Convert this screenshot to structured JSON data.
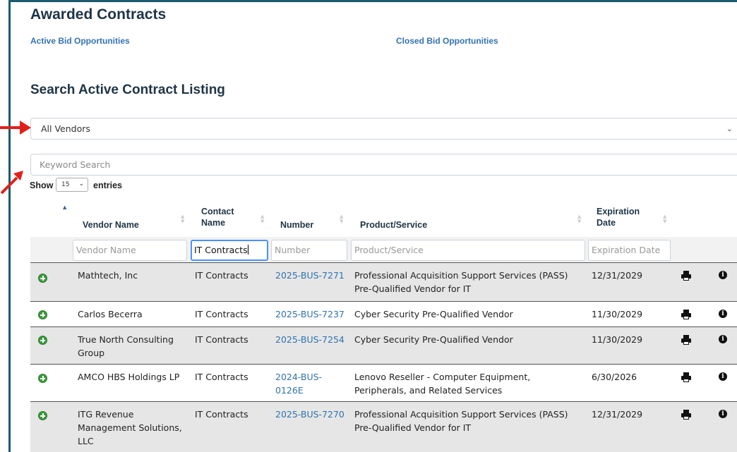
{
  "page": {
    "title": "Awarded Contracts",
    "links": {
      "active": "Active Bid Opportunities",
      "closed": "Closed Bid Opportunities"
    },
    "search_title": "Search Active Contract Listing"
  },
  "filters": {
    "vendor_select": "All Vendors",
    "keyword_placeholder": "Keyword Search"
  },
  "table_controls": {
    "show_label": "Show",
    "entries_value": "15",
    "entries_label": "entries"
  },
  "columns": {
    "vendor": "Vendor Name",
    "contact_1": "Contact",
    "contact_2": "Name",
    "number": "Number",
    "product": "Product/Service",
    "exp_1": "Expiration",
    "exp_2": "Date"
  },
  "column_filters": {
    "vendor_placeholder": "Vendor Name",
    "contact_value": "IT Contracts",
    "number_placeholder": "Number",
    "product_placeholder": "Product/Service",
    "expiration_placeholder": "Expiration Date"
  },
  "rows": [
    {
      "vendor": [
        "Mathtech, Inc"
      ],
      "contact": "IT Contracts",
      "number": [
        "2025-BUS-7271"
      ],
      "product": [
        "Professional Acquisition Support Services (PASS)",
        "Pre-Qualified Vendor for IT"
      ],
      "expiration": "12/31/2029"
    },
    {
      "vendor": [
        "Carlos Becerra"
      ],
      "contact": "IT Contracts",
      "number": [
        "2025-BUS-7237"
      ],
      "product": [
        "Cyber Security Pre-Qualified Vendor"
      ],
      "expiration": "11/30/2029"
    },
    {
      "vendor": [
        "True North Consulting",
        "Group"
      ],
      "contact": "IT Contracts",
      "number": [
        "2025-BUS-7254"
      ],
      "product": [
        "Cyber Security Pre-Qualified Vendor"
      ],
      "expiration": "11/30/2029"
    },
    {
      "vendor": [
        "AMCO HBS Holdings LP"
      ],
      "contact": "IT Contracts",
      "number": [
        "2024-BUS-",
        "0126E"
      ],
      "product": [
        "Lenovo Reseller - Computer Equipment,",
        "Peripherals, and Related Services"
      ],
      "expiration": "6/30/2026"
    },
    {
      "vendor": [
        "ITG Revenue",
        "Management Solutions,",
        "LLC"
      ],
      "contact": "IT Contracts",
      "number": [
        "2025-BUS-7270"
      ],
      "product": [
        "Professional Acquisition Support Services (PASS)",
        "Pre-Qualified Vendor for IT"
      ],
      "expiration": "12/31/2029"
    }
  ],
  "colors": {
    "accent": "#1c5a6e",
    "link": "#3372b5",
    "annotation": "#e0201c",
    "add_icon": "#3b9a3b"
  },
  "icons": {
    "expand": "plus-circle-icon",
    "print": "print-icon",
    "info": "info-circle-icon"
  }
}
